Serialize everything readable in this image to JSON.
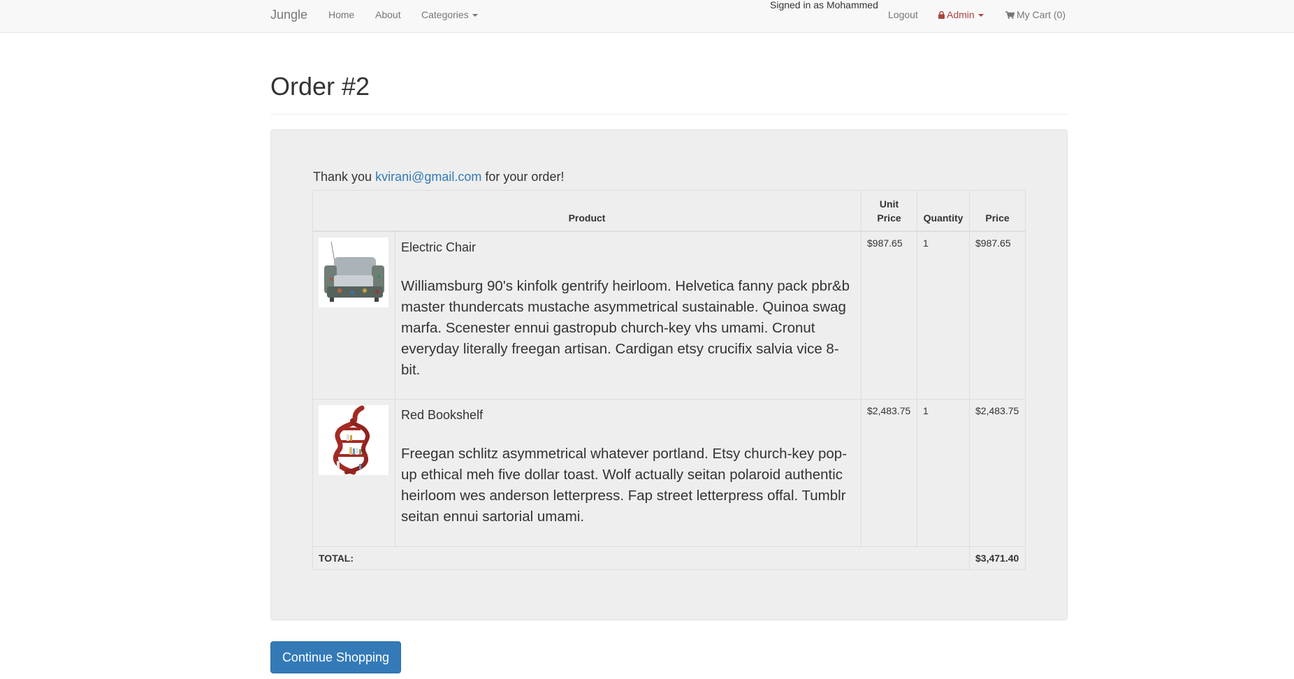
{
  "navbar": {
    "brand": "Jungle",
    "links": {
      "home": "Home",
      "about": "About",
      "categories": "Categories"
    },
    "signed_in": "Signed in as Mohammed",
    "logout": "Logout",
    "admin": "Admin",
    "cart": "My Cart (0)",
    "admin_icon": "lock-icon",
    "cart_icon": "shopping-cart-icon"
  },
  "page": {
    "title": "Order #2"
  },
  "order": {
    "thanks_prefix": "Thank you",
    "email": "kvirani@gmail.com",
    "thanks_suffix": "for your order!",
    "headers": {
      "product": "Product",
      "unit_price": "Unit Price",
      "quantity": "Quantity",
      "price": "Price"
    },
    "items": [
      {
        "name": "Electric Chair",
        "description": "Williamsburg 90's kinfolk gentrify heirloom. Helvetica fanny pack pbr&b master thundercats mustache asymmetrical sustainable. Quinoa swag marfa. Scenester ennui gastropub church-key vhs umami. Cronut everyday literally freegan artisan. Cardigan etsy crucifix salvia vice 8-bit.",
        "unit_price": "$987.65",
        "quantity": "1",
        "price": "$987.65",
        "image_icon": "electric-chair-image"
      },
      {
        "name": "Red Bookshelf",
        "description": "Freegan schlitz asymmetrical whatever portland. Etsy church-key pop-up ethical meh five dollar toast. Wolf actually seitan polaroid authentic heirloom wes anderson letterpress. Fap street letterpress offal. Tumblr seitan ennui sartorial umami.",
        "unit_price": "$2,483.75",
        "quantity": "1",
        "price": "$2,483.75",
        "image_icon": "red-bookshelf-image"
      }
    ],
    "total_label": "TOTAL:",
    "total": "$3,471.40"
  },
  "actions": {
    "continue": "Continue Shopping"
  },
  "colors": {
    "link": "#337ab7",
    "admin": "#a94442",
    "primary_button": "#337ab7",
    "panel": "#eeeeee",
    "navbar": "#f8f8f8"
  }
}
